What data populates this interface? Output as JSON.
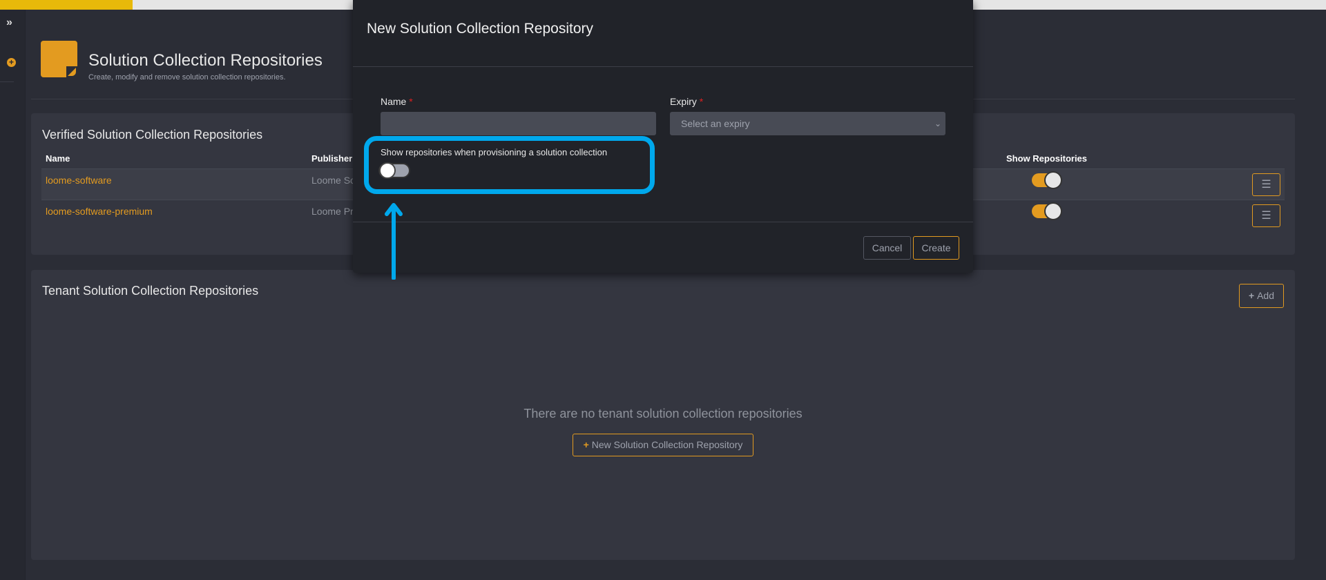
{
  "colors": {
    "accent": "#e39b20",
    "highlight": "#00a8ec",
    "background": "#2b2d36"
  },
  "loading_progress_percent": 10,
  "sidebar": {
    "expand_icon": "chevron-double-right-icon",
    "add_icon": "plus-circle-icon"
  },
  "page": {
    "title": "Solution Collection Repositories",
    "subtitle": "Create, modify and remove solution collection repositories.",
    "icon": "note-icon"
  },
  "verified": {
    "title": "Verified Solution Collection Repositories",
    "columns": [
      "Name",
      "Publisher",
      "Show Repositories"
    ],
    "rows": [
      {
        "name": "loome-software",
        "publisher": "Loome So",
        "show": true
      },
      {
        "name": "loome-software-premium",
        "publisher": "Loome Pr",
        "show": true
      }
    ]
  },
  "tenant": {
    "title": "Tenant Solution Collection Repositories",
    "add_label": "Add",
    "empty_text": "There are no tenant solution collection repositories",
    "new_label": "New Solution Collection Repository"
  },
  "modal": {
    "title": "New Solution Collection Repository",
    "name_label": "Name",
    "name_value": "",
    "expiry_label": "Expiry",
    "expiry_placeholder": "Select an expiry",
    "required_mark": "*",
    "show_label": "Show repositories when provisioning a solution collection",
    "show_value": false,
    "cancel_label": "Cancel",
    "create_label": "Create"
  }
}
